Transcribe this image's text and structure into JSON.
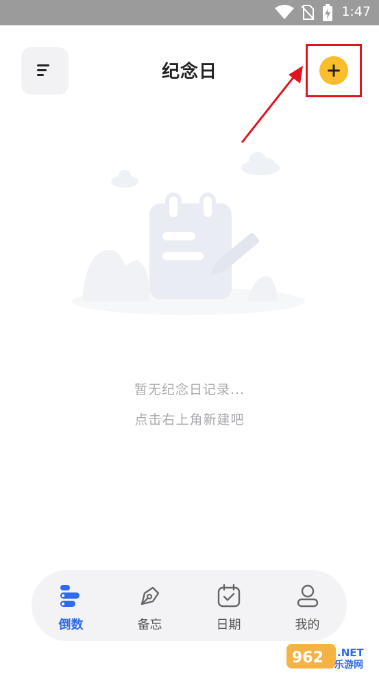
{
  "status_bar": {
    "time": "1:47",
    "icons": [
      "wifi-icon",
      "no-sim-icon",
      "battery-charging-icon"
    ]
  },
  "header": {
    "title": "纪念日",
    "menu_icon": "menu-icon",
    "add_icon": "plus-icon",
    "add_color": "#fbbd2b"
  },
  "annotation": {
    "highlight_color": "#e0141e"
  },
  "empty_state": {
    "illustration": "notepad-pencil-illustration",
    "line1": "暂无纪念日记录...",
    "line2": "点击右上角新建吧"
  },
  "tabbar": {
    "active_color": "#2f6bea",
    "tabs": [
      {
        "label": "倒数",
        "icon": "countdown-icon",
        "active": true
      },
      {
        "label": "备忘",
        "icon": "pen-nib-icon",
        "active": false
      },
      {
        "label": "日期",
        "icon": "calendar-check-icon",
        "active": false
      },
      {
        "label": "我的",
        "icon": "user-icon",
        "active": false
      }
    ]
  },
  "watermark": {
    "brand": "962.NET",
    "sub": "乐游网"
  }
}
